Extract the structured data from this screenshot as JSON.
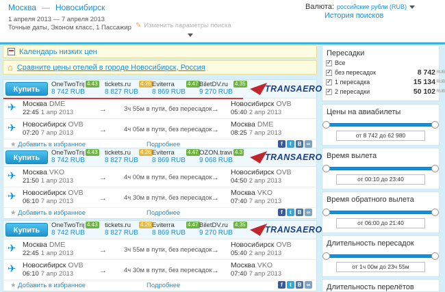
{
  "header": {
    "route_from": "Москва",
    "route_dash": "—",
    "route_to": "Новосибирск",
    "dates": "1 апреля 2013 — 7 апреля 2013",
    "details": "Точные даты, Эконом класс, 1 Пассажир",
    "edit_label": "Изменить параметры поиска",
    "currency_label": "Валюта:",
    "currency_value": "российские рубли (RUB)",
    "history": "История поисков"
  },
  "promos": {
    "calendar": "Календарь низких цен",
    "hotels": "Сравните цены отелей в городе Новосибирск, Россия"
  },
  "labels": {
    "buy": "Купить",
    "favorite": "Добавить в избранное",
    "more": "Подробнее",
    "airline": "TRANSAERO",
    "social": [
      "f",
      "t",
      "В",
      "∞"
    ]
  },
  "results": [
    {
      "agents": [
        {
          "name": "OneTwoTrip",
          "rating": "4.43",
          "price": "8 742 RUB"
        },
        {
          "name": "tickets.ru",
          "rating": "4.26",
          "price": "8 827 RUB"
        },
        {
          "name": "Eviterra",
          "rating": "4.47",
          "price": "8 869 RUB"
        },
        {
          "name": "BiletDV.ru",
          "rating": "4.35",
          "price": "9 270 RUB"
        }
      ],
      "segments": [
        {
          "from_city": "Москва",
          "from_code": "DME",
          "dep_time": "22:45",
          "dep_date": "1 апр 2013",
          "duration": "3ч 55м в пути, без пересадок",
          "to_city": "Новосибирск",
          "to_code": "OVB",
          "arr_time": "05:40",
          "arr_date": "2 апр 2013"
        },
        {
          "from_city": "Новосибирск",
          "from_code": "OVB",
          "dep_time": "07:20",
          "dep_date": "7 апр 2013",
          "duration": "4ч 05м в пути, без пересадок",
          "to_city": "Москва",
          "to_code": "DME",
          "arr_time": "08:25",
          "arr_date": "7 апр 2013"
        }
      ]
    },
    {
      "agents": [
        {
          "name": "OneTwoTrip",
          "rating": "4.43",
          "price": "8 742 RUB"
        },
        {
          "name": "tickets.ru",
          "rating": "4.26",
          "price": "8 827 RUB"
        },
        {
          "name": "Eviterra",
          "rating": "4.47",
          "price": "8 869 RUB"
        },
        {
          "name": "OZON.travel",
          "rating": "4.3",
          "price": "9 068 RUB"
        }
      ],
      "segments": [
        {
          "from_city": "Москва",
          "from_code": "VKO",
          "dep_time": "21:50",
          "dep_date": "1 апр 2013",
          "duration": "4ч 00м в пути, без пересадок",
          "to_city": "Новосибирск",
          "to_code": "OVB",
          "arr_time": "04:50",
          "arr_date": "2 апр 2013"
        },
        {
          "from_city": "Новосибирск",
          "from_code": "OVB",
          "dep_time": "06:10",
          "dep_date": "7 апр 2013",
          "duration": "4ч 30м в пути, без пересадок",
          "to_city": "Москва",
          "to_code": "VKO",
          "arr_time": "07:40",
          "arr_date": "7 апр 2013"
        }
      ]
    },
    {
      "agents": [
        {
          "name": "OneTwoTrip",
          "rating": "4.43",
          "price": "8 742 RUB"
        },
        {
          "name": "tickets.ru",
          "rating": "4.26",
          "price": "8 827 RUB"
        },
        {
          "name": "Eviterra",
          "rating": "4.47",
          "price": "8 869 RUB"
        },
        {
          "name": "BiletDV.ru",
          "rating": "4.35",
          "price": "9 270 RUB"
        }
      ],
      "segments": [
        {
          "from_city": "Москва",
          "from_code": "DME",
          "dep_time": "22:45",
          "dep_date": "1 апр 2013",
          "duration": "3ч 55м в пути, без пересадок",
          "to_city": "Новосибирск",
          "to_code": "OVB",
          "arr_time": "05:40",
          "arr_date": "2 апр 2013"
        },
        {
          "from_city": "Новосибирск",
          "from_code": "OVB",
          "dep_time": "06:10",
          "dep_date": "7 апр 2013",
          "duration": "4ч 30м в пути, без пересадок",
          "to_city": "Москва",
          "to_code": "VKO",
          "arr_time": "07:40",
          "arr_date": "7 апр 2013"
        }
      ]
    }
  ],
  "filters": {
    "stops_title": "Пересадки",
    "stops": [
      {
        "label": "Все",
        "price": ""
      },
      {
        "label": "без пересадок",
        "price": "8 742"
      },
      {
        "label": "1 пересадка",
        "price": "15 134"
      },
      {
        "label": "2 пересадки",
        "price": "50 102"
      }
    ],
    "rub": "RUB",
    "price_title": "Цены на авиабилеты",
    "price_value": "от 8 742 до 62 980",
    "dep_title": "Время вылета",
    "dep_value": "от 00:10 до 23:40",
    "ret_title": "Время обратного вылета",
    "ret_value": "от 06:00 до 21:40",
    "layover_title": "Длительность пересадок",
    "layover_value": "от 1ч 00м до 23ч 55м",
    "flight_title": "Длительность перелётов"
  }
}
